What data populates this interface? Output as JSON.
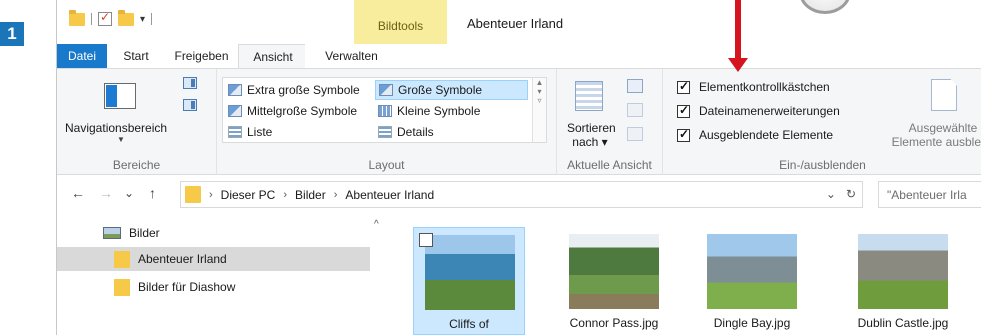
{
  "step_badge": "1",
  "title_bar": {
    "context_tab_group": "Bildtools",
    "window_title": "Abenteuer Irland",
    "qat_dropdown": "▾"
  },
  "ribbon_tabs": [
    "Datei",
    "Start",
    "Freigeben",
    "Ansicht",
    "Verwalten"
  ],
  "ribbon": {
    "bereiche": {
      "nav_pane_label": "Navigationsbereich",
      "group_label": "Bereiche"
    },
    "layout": {
      "items": [
        "Extra große Symbole",
        "Große Symbole",
        "Mittelgroße Symbole",
        "Kleine Symbole",
        "Liste",
        "Details"
      ],
      "selected": "Große Symbole",
      "group_label": "Layout"
    },
    "current_view": {
      "sort_label_line1": "Sortieren",
      "sort_label_line2": "nach ▾",
      "group_label": "Aktuelle Ansicht"
    },
    "show_hide": {
      "checkboxes": [
        {
          "label": "Elementkontrollkästchen",
          "checked": true
        },
        {
          "label": "Dateinamenerweiterungen",
          "checked": true
        },
        {
          "label": "Ausgeblendete Elemente",
          "checked": true
        }
      ],
      "hide_selected_line1": "Ausgewählte",
      "hide_selected_line2": "Elemente ausblend",
      "group_label": "Ein-/ausblenden"
    }
  },
  "address_bar": {
    "back": "←",
    "forward": "→",
    "recent": "⌄",
    "up": "↑",
    "segments": [
      "Dieser PC",
      "Bilder",
      "Abenteuer Irland"
    ],
    "separator": "›",
    "dropdown": "⌄",
    "refresh": "↻",
    "search_placeholder": "\"Abenteuer Irla"
  },
  "nav_pane": {
    "items": [
      "Bilder",
      "Abenteuer Irland",
      "Bilder für Diashow"
    ],
    "selected": "Abenteuer Irland",
    "scroll_up": "^"
  },
  "files": [
    {
      "name": "Cliffs of",
      "selected": true,
      "icon": "photo-cliffs"
    },
    {
      "name": "Connor Pass.jpg",
      "selected": false,
      "icon": "photo-connor-pass"
    },
    {
      "name": "Dingle Bay.jpg",
      "selected": false,
      "icon": "photo-dingle-bay"
    },
    {
      "name": "Dublin Castle.jpg",
      "selected": false,
      "icon": "photo-dublin-castle"
    }
  ],
  "colors": {
    "accent_blue": "#1979ca",
    "context_tab": "#f8ed9c",
    "annotation_arrow": "#d5141d",
    "selection": "#cce8ff"
  }
}
